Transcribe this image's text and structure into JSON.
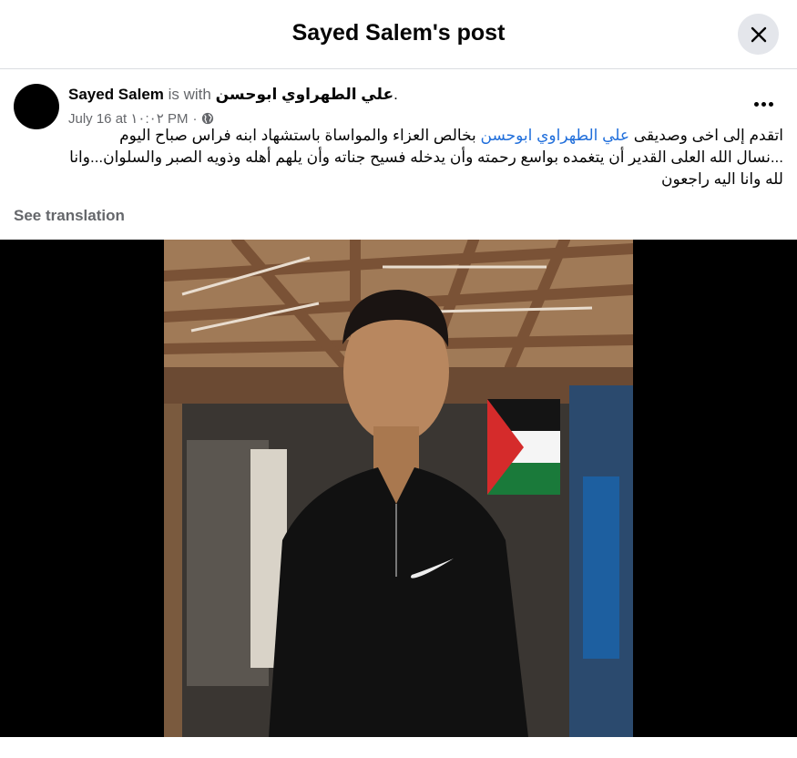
{
  "header": {
    "title": "Sayed Salem's post",
    "close_icon": "close-icon"
  },
  "post": {
    "author": "Sayed Salem",
    "is_with": " is with ",
    "tagged_user": "علي الطهراوي ابوحسن",
    "tagged_suffix": ".",
    "timestamp": "July 16 at ١٠:٠٢ PM",
    "separator": "·",
    "audience_icon": "globe-icon",
    "more_icon": "more-options-icon",
    "text": {
      "line1_before": "اتقدم إلى اخى وصديقى ",
      "mention": "علي الطهراوي ابوحسن",
      "line1_after": "  بخالص العزاء والمواساة باستشهاد ابنه فراس صباح اليوم",
      "line2": "...نسال الله العلى القدير أن يتغمده بواسع رحمته وأن يدخله فسيح جناته وأن يلهم أهله وذويه الصبر والسلوان...وانا",
      "line3": "لله وانا اليه راجعون"
    },
    "see_translation": "See translation"
  },
  "photo": {
    "logo_icon": "nike-swoosh-icon",
    "background_color": "#000000"
  },
  "colors": {
    "link": "#216fdb",
    "secondary_text": "#65676b",
    "close_bg": "#e4e6eb"
  }
}
